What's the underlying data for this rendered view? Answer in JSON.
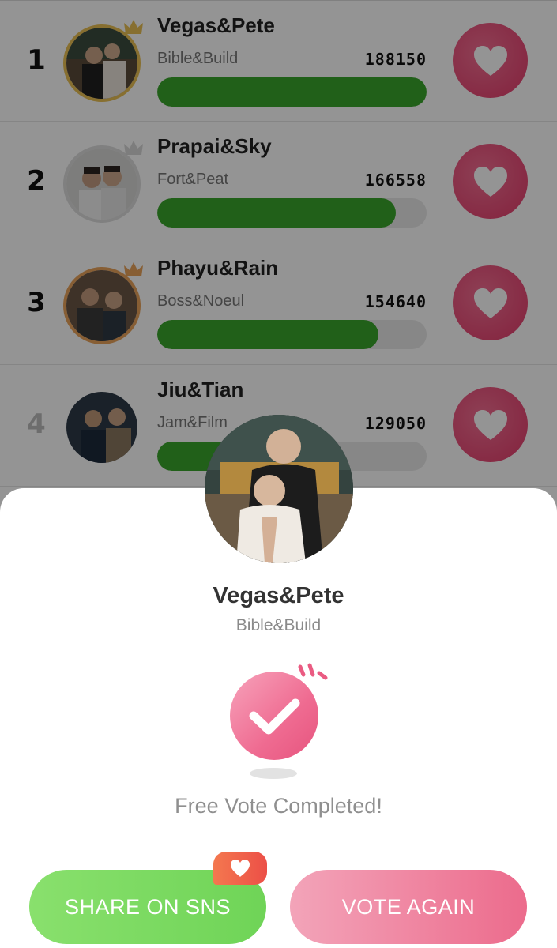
{
  "ranking": [
    {
      "rank": "1",
      "pair": "Vegas&Pete",
      "actors": "Bible&Build",
      "votes": "188150",
      "progress": 1.0,
      "medal": "gold"
    },
    {
      "rank": "2",
      "pair": "Prapai&Sky",
      "actors": "Fort&Peat",
      "votes": "166558",
      "progress": 0.885,
      "medal": "silver"
    },
    {
      "rank": "3",
      "pair": "Phayu&Rain",
      "actors": "Boss&Noeul",
      "votes": "154640",
      "progress": 0.822,
      "medal": "bronze"
    },
    {
      "rank": "4",
      "pair": "Jiu&Tian",
      "actors": "Jam&Film",
      "votes": "129050",
      "progress": 0.686,
      "medal": "none"
    }
  ],
  "sheet": {
    "pair": "Vegas&Pete",
    "actors": "Bible&Build",
    "status": "Free Vote Completed!",
    "share_label": "SHARE ON SNS",
    "vote_again_label": "VOTE AGAIN"
  },
  "colors": {
    "progress_green": "#3aa52b",
    "heart_pink": "#e84a76",
    "share_green": "#7bd862",
    "vote_pink": "#ee7a98"
  },
  "icons": {
    "vote": "heart-icon",
    "medal": "crown-icon",
    "success": "check-icon"
  }
}
